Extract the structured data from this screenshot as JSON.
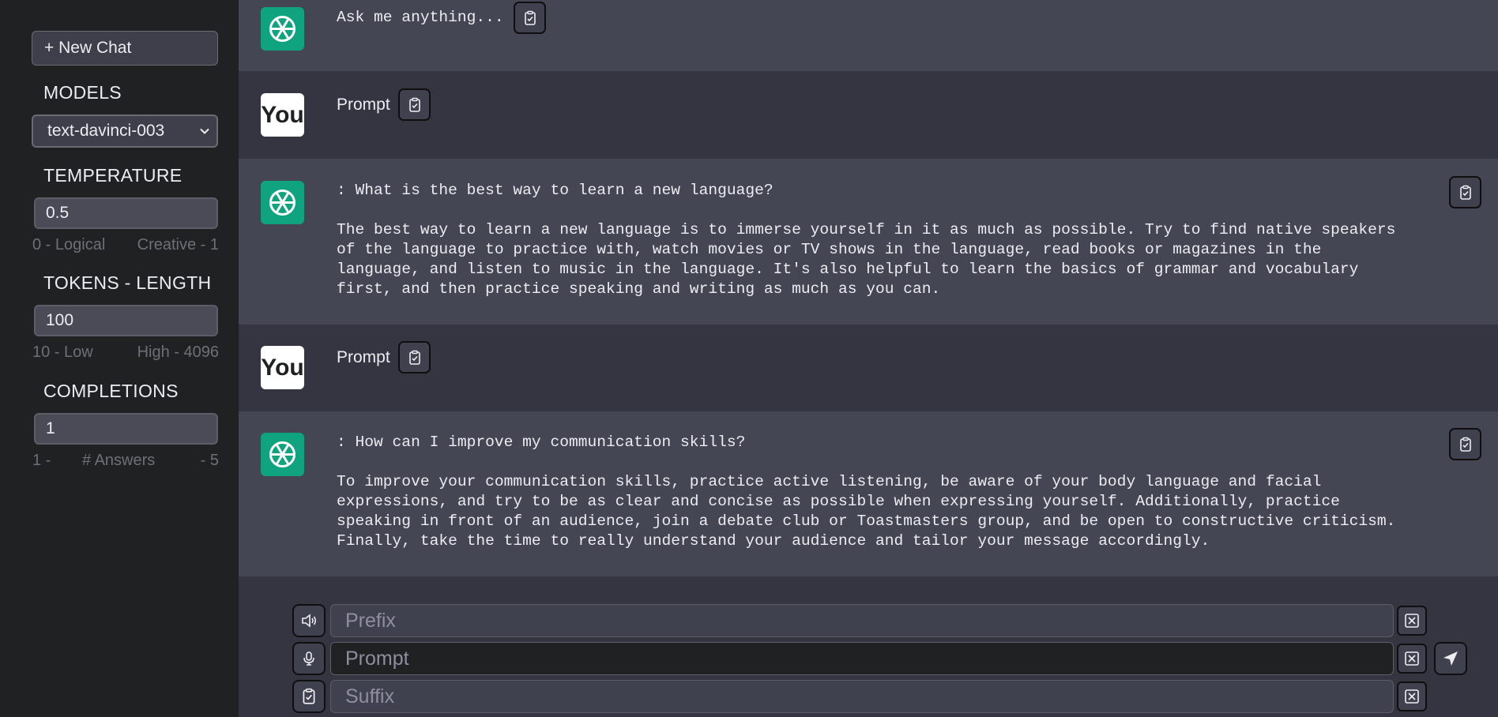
{
  "sidebar": {
    "new_chat_label": "+ New Chat",
    "models_heading": "MODELS",
    "model_selected": "text-davinci-003",
    "temperature_heading": "TEMPERATURE",
    "temperature_value": "0.5",
    "temperature_min_label": "0 - Logical",
    "temperature_max_label": "Creative - 1",
    "tokens_heading": "TOKENS - LENGTH",
    "tokens_value": "100",
    "tokens_min_label": "10 - Low",
    "tokens_max_label": "High - 4096",
    "completions_heading": "COMPLETIONS",
    "completions_value": "1",
    "completions_min_label": "1 -",
    "completions_mid_label": "# Answers",
    "completions_max_label": "- 5"
  },
  "messages": [
    {
      "role": "bot",
      "text": "Ask me anything..."
    },
    {
      "role": "user",
      "avatar_text": "You",
      "text": "Prompt"
    },
    {
      "role": "bot",
      "text": ": What is the best way to learn a new language?\n\nThe best way to learn a new language is to immerse yourself in it as much as possible. Try to find native speakers\nof the language to practice with, watch movies or TV shows in the language, read books or magazines in the\nlanguage, and listen to music in the language. It's also helpful to learn the basics of grammar and vocabulary\nfirst, and then practice speaking and writing as much as you can."
    },
    {
      "role": "user",
      "avatar_text": "You",
      "text": "Prompt"
    },
    {
      "role": "bot",
      "text": ": How can I improve my communication skills?\n\nTo improve your communication skills, practice active listening, be aware of your body language and facial\nexpressions, and try to be as clear and concise as possible when expressing yourself. Additionally, practice\nspeaking in front of an audience, join a debate club or Toastmasters group, and be open to constructive criticism.\nFinally, take the time to really understand your audience and tailor your message accordingly."
    }
  ],
  "input": {
    "prefix_placeholder": "Prefix",
    "prompt_placeholder": "Prompt",
    "suffix_placeholder": "Suffix"
  },
  "colors": {
    "sidebar_bg": "#202123",
    "bot_row_bg": "#444654",
    "user_row_bg": "#343541",
    "gpt_avatar": "#10a37f"
  }
}
